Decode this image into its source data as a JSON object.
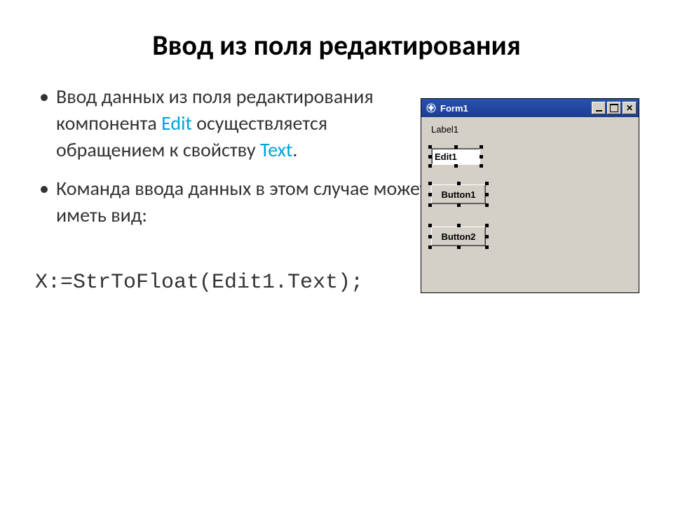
{
  "title": "Ввод из поля редактирования",
  "bullets": {
    "item1_pre": "Ввод данных из поля редактирования компонента ",
    "item1_kw1": "Edit",
    "item1_mid": " осуществляется обращением к свойству ",
    "item1_kw2": "Text",
    "item1_post": ".",
    "item2": "Команда ввода данных в этом случае может иметь вид:"
  },
  "code": "X:=StrToFloat(Edit1.Text);",
  "window": {
    "title": "Form1",
    "label": "Label1",
    "edit_value": "Edit1",
    "button1": "Button1",
    "button2": "Button2"
  }
}
